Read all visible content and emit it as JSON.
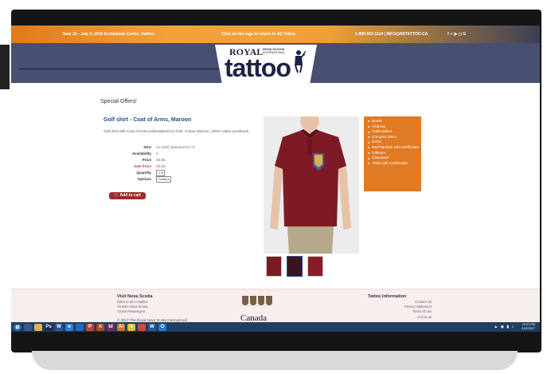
{
  "topbar": {
    "dates": "June 26 - July 3, 2016 Scotiabank Centre, Halifax",
    "hint": "Click on the logo to return to NS Tattoo",
    "contact": "1-800-563-1114 | INFO@NSTATTOO.CA",
    "social_icons": "f ✓ ▶ ◻ G"
  },
  "logo": {
    "royal": "ROYAL",
    "nova_scotia": "NOVA SCOTIA",
    "international": "INTERNATIONAL",
    "tattoo": "tattoo"
  },
  "page": {
    "special": "Special Offers!"
  },
  "product": {
    "title": "Golf shirt - Coat of Arms, Maroon",
    "description": "Golf shirt with Coat of Arms embroidered on front. Colour Maroon. 100% cotton preshrunk.",
    "specs": [
      {
        "label": "SKU",
        "value": "CL-Golf_MaroonCOA-S"
      },
      {
        "label": "Availability",
        "value": "1"
      },
      {
        "label": "Price",
        "value": "34.95"
      },
      {
        "label": "Sale Price",
        "value": "20.00"
      },
      {
        "label": "Quantity",
        "value": "1"
      },
      {
        "label": "Options",
        "value": "Small"
      }
    ],
    "cart_label": "Add to cart",
    "cart_icon": "🛒"
  },
  "menu": [
    "Books",
    "Clothing",
    "Collectables",
    "Compact Discs",
    "DVDs",
    "Merchandise Gift Certificates",
    "Giftware",
    "Glassware",
    "Ticket Gift Certificates"
  ],
  "footer": {
    "visit_heading": "Visit Nova Scotia",
    "visit_links": [
      "What to do in Halifax",
      "Tourism Nova Scotia",
      "Cruise Passengers"
    ],
    "copyright": "© 2017 The Royal Nova Scotia International",
    "canada": "Canada",
    "info_heading": "Tattoo Information",
    "info_links": [
      "Contact Us",
      "Privacy Statement",
      "Terms of use",
      "Link to us"
    ]
  },
  "taskbar": {
    "clock": "12:01 PM",
    "date": "21/2/2017",
    "icons": [
      "windows-start",
      "explorer",
      "folder",
      "photoshop",
      "word",
      "edge",
      "chrome",
      "powerpoint",
      "illustrator",
      "acrobat",
      "outlook"
    ]
  },
  "colors": {
    "banner": "#474f72",
    "accent_orange": "#e07a25",
    "title_blue": "#2a4c8a",
    "cart_red": "#a12b2b"
  }
}
